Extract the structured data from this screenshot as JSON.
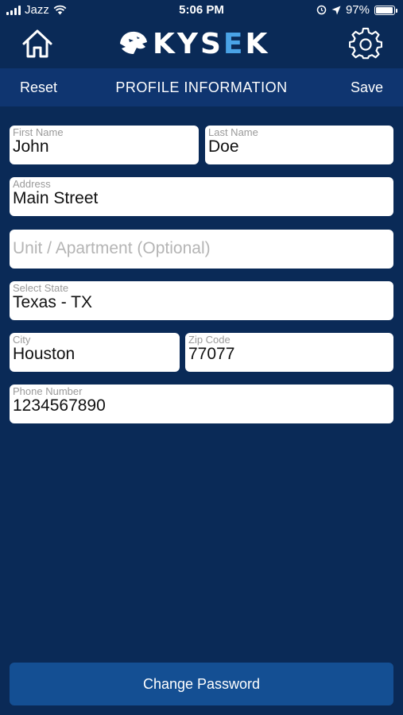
{
  "status_bar": {
    "carrier": "Jazz",
    "time": "5:06 PM",
    "battery_percent": "97%",
    "battery_level": 0.97
  },
  "header": {
    "logo_text_a": "KYS",
    "logo_text_b": "E",
    "logo_text_c": "K",
    "home_icon": "home-icon",
    "settings_icon": "gear-icon"
  },
  "nav": {
    "left_label": "Reset",
    "title": "PROFILE INFORMATION",
    "right_label": "Save"
  },
  "form": {
    "first_name": {
      "label": "First Name",
      "value": "John"
    },
    "last_name": {
      "label": "Last Name",
      "value": "Doe"
    },
    "address": {
      "label": "Address",
      "value": "Main Street"
    },
    "unit": {
      "placeholder": "Unit / Apartment (Optional)",
      "value": ""
    },
    "state": {
      "label": "Select State",
      "value": "Texas - TX"
    },
    "city": {
      "label": "City",
      "value": "Houston"
    },
    "zip": {
      "label": "Zip Code",
      "value": "77077"
    },
    "phone": {
      "label": "Phone Number",
      "value": "1234567890"
    }
  },
  "footer": {
    "change_password_label": "Change Password"
  },
  "colors": {
    "background": "#0a2a57",
    "nav_bar": "#0f3570",
    "button": "#144f93",
    "logo_accent": "#4aa3e6"
  }
}
